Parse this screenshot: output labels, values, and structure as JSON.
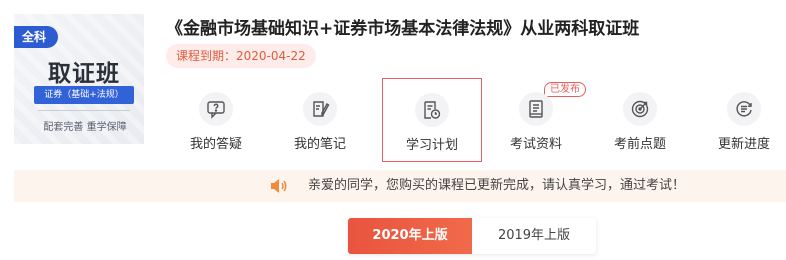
{
  "thumbnail": {
    "tag": "全科",
    "title": "取证班",
    "subtitle": "证券（基础+法规）",
    "footer": "配套完善  重学保障"
  },
  "course": {
    "title": "《金融市场基础知识+证券市场基本法律法规》从业两科取证班",
    "expiry": "课程到期：2020-04-22"
  },
  "menu": [
    {
      "label": "我的答疑",
      "icon": "chat-question-icon",
      "active": false,
      "badge": ""
    },
    {
      "label": "我的笔记",
      "icon": "notebook-pen-icon",
      "active": false,
      "badge": ""
    },
    {
      "label": "学习计划",
      "icon": "plan-clock-icon",
      "active": true,
      "badge": ""
    },
    {
      "label": "考试资料",
      "icon": "document-book-icon",
      "active": false,
      "badge": "已发布"
    },
    {
      "label": "考前点题",
      "icon": "target-icon",
      "active": false,
      "badge": ""
    },
    {
      "label": "更新进度",
      "icon": "update-list-icon",
      "active": false,
      "badge": ""
    }
  ],
  "notice": {
    "icon": "speaker-icon",
    "text": "亲爱的同学，您购买的课程已更新完成，请认真学习，通过考试！"
  },
  "year_tabs": [
    {
      "label": "2020年上版",
      "active": true
    },
    {
      "label": "2019年上版",
      "active": false
    }
  ],
  "colors": {
    "accent": "#e9543e",
    "active_border": "#e85d5d",
    "notice_bg": "#fdf4ee",
    "expiry_bg": "#fdecea",
    "thumb_blue": "#2d5bd1"
  }
}
